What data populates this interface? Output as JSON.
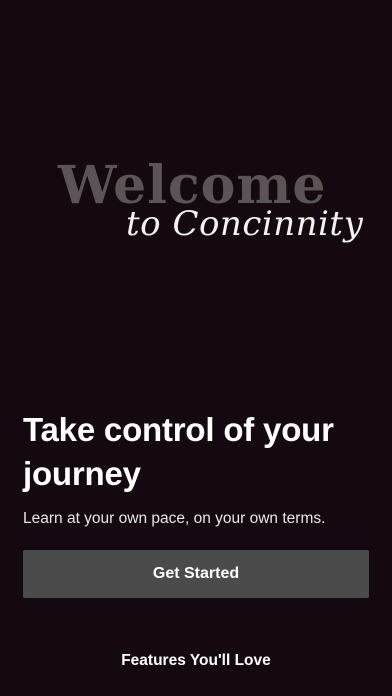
{
  "hero": {
    "welcome": "Welcome",
    "script_line": "to Concinnity"
  },
  "headline": "Take control of your journey",
  "subhead": "Learn at your own pace, on your own terms.",
  "cta": {
    "label": "Get Started"
  },
  "features": {
    "title": "Features You'll Love"
  },
  "colors": {
    "background": "#140910",
    "button": "#4b4b4b",
    "welcome_text": "#5a5457",
    "text": "#ffffff"
  }
}
